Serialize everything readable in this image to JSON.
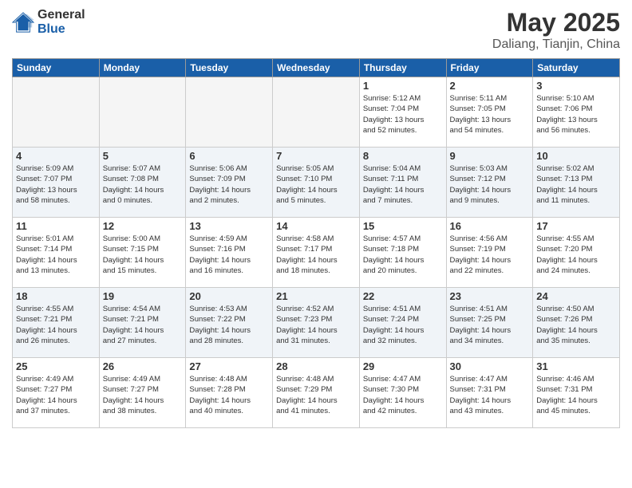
{
  "logo": {
    "general": "General",
    "blue": "Blue"
  },
  "title": "May 2025",
  "subtitle": "Daliang, Tianjin, China",
  "weekdays": [
    "Sunday",
    "Monday",
    "Tuesday",
    "Wednesday",
    "Thursday",
    "Friday",
    "Saturday"
  ],
  "weeks": [
    [
      {
        "day": "",
        "info": ""
      },
      {
        "day": "",
        "info": ""
      },
      {
        "day": "",
        "info": ""
      },
      {
        "day": "",
        "info": ""
      },
      {
        "day": "1",
        "info": "Sunrise: 5:12 AM\nSunset: 7:04 PM\nDaylight: 13 hours\nand 52 minutes."
      },
      {
        "day": "2",
        "info": "Sunrise: 5:11 AM\nSunset: 7:05 PM\nDaylight: 13 hours\nand 54 minutes."
      },
      {
        "day": "3",
        "info": "Sunrise: 5:10 AM\nSunset: 7:06 PM\nDaylight: 13 hours\nand 56 minutes."
      }
    ],
    [
      {
        "day": "4",
        "info": "Sunrise: 5:09 AM\nSunset: 7:07 PM\nDaylight: 13 hours\nand 58 minutes."
      },
      {
        "day": "5",
        "info": "Sunrise: 5:07 AM\nSunset: 7:08 PM\nDaylight: 14 hours\nand 0 minutes."
      },
      {
        "day": "6",
        "info": "Sunrise: 5:06 AM\nSunset: 7:09 PM\nDaylight: 14 hours\nand 2 minutes."
      },
      {
        "day": "7",
        "info": "Sunrise: 5:05 AM\nSunset: 7:10 PM\nDaylight: 14 hours\nand 5 minutes."
      },
      {
        "day": "8",
        "info": "Sunrise: 5:04 AM\nSunset: 7:11 PM\nDaylight: 14 hours\nand 7 minutes."
      },
      {
        "day": "9",
        "info": "Sunrise: 5:03 AM\nSunset: 7:12 PM\nDaylight: 14 hours\nand 9 minutes."
      },
      {
        "day": "10",
        "info": "Sunrise: 5:02 AM\nSunset: 7:13 PM\nDaylight: 14 hours\nand 11 minutes."
      }
    ],
    [
      {
        "day": "11",
        "info": "Sunrise: 5:01 AM\nSunset: 7:14 PM\nDaylight: 14 hours\nand 13 minutes."
      },
      {
        "day": "12",
        "info": "Sunrise: 5:00 AM\nSunset: 7:15 PM\nDaylight: 14 hours\nand 15 minutes."
      },
      {
        "day": "13",
        "info": "Sunrise: 4:59 AM\nSunset: 7:16 PM\nDaylight: 14 hours\nand 16 minutes."
      },
      {
        "day": "14",
        "info": "Sunrise: 4:58 AM\nSunset: 7:17 PM\nDaylight: 14 hours\nand 18 minutes."
      },
      {
        "day": "15",
        "info": "Sunrise: 4:57 AM\nSunset: 7:18 PM\nDaylight: 14 hours\nand 20 minutes."
      },
      {
        "day": "16",
        "info": "Sunrise: 4:56 AM\nSunset: 7:19 PM\nDaylight: 14 hours\nand 22 minutes."
      },
      {
        "day": "17",
        "info": "Sunrise: 4:55 AM\nSunset: 7:20 PM\nDaylight: 14 hours\nand 24 minutes."
      }
    ],
    [
      {
        "day": "18",
        "info": "Sunrise: 4:55 AM\nSunset: 7:21 PM\nDaylight: 14 hours\nand 26 minutes."
      },
      {
        "day": "19",
        "info": "Sunrise: 4:54 AM\nSunset: 7:21 PM\nDaylight: 14 hours\nand 27 minutes."
      },
      {
        "day": "20",
        "info": "Sunrise: 4:53 AM\nSunset: 7:22 PM\nDaylight: 14 hours\nand 28 minutes."
      },
      {
        "day": "21",
        "info": "Sunrise: 4:52 AM\nSunset: 7:23 PM\nDaylight: 14 hours\nand 31 minutes."
      },
      {
        "day": "22",
        "info": "Sunrise: 4:51 AM\nSunset: 7:24 PM\nDaylight: 14 hours\nand 32 minutes."
      },
      {
        "day": "23",
        "info": "Sunrise: 4:51 AM\nSunset: 7:25 PM\nDaylight: 14 hours\nand 34 minutes."
      },
      {
        "day": "24",
        "info": "Sunrise: 4:50 AM\nSunset: 7:26 PM\nDaylight: 14 hours\nand 35 minutes."
      }
    ],
    [
      {
        "day": "25",
        "info": "Sunrise: 4:49 AM\nSunset: 7:27 PM\nDaylight: 14 hours\nand 37 minutes."
      },
      {
        "day": "26",
        "info": "Sunrise: 4:49 AM\nSunset: 7:27 PM\nDaylight: 14 hours\nand 38 minutes."
      },
      {
        "day": "27",
        "info": "Sunrise: 4:48 AM\nSunset: 7:28 PM\nDaylight: 14 hours\nand 40 minutes."
      },
      {
        "day": "28",
        "info": "Sunrise: 4:48 AM\nSunset: 7:29 PM\nDaylight: 14 hours\nand 41 minutes."
      },
      {
        "day": "29",
        "info": "Sunrise: 4:47 AM\nSunset: 7:30 PM\nDaylight: 14 hours\nand 42 minutes."
      },
      {
        "day": "30",
        "info": "Sunrise: 4:47 AM\nSunset: 7:31 PM\nDaylight: 14 hours\nand 43 minutes."
      },
      {
        "day": "31",
        "info": "Sunrise: 4:46 AM\nSunset: 7:31 PM\nDaylight: 14 hours\nand 45 minutes."
      }
    ]
  ]
}
